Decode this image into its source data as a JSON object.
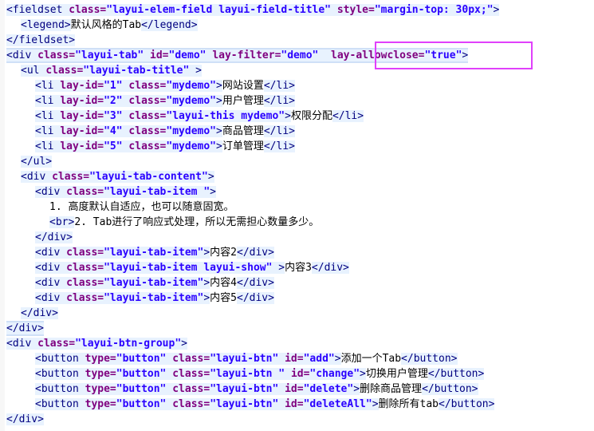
{
  "lines": [
    {
      "indent": 0,
      "segments": [
        {
          "t": "<fieldset ",
          "c": "tag"
        },
        {
          "t": "class=",
          "c": "attr"
        },
        {
          "t": "\"layui-elem-field layui-field-title\" ",
          "c": "val"
        },
        {
          "t": "style=",
          "c": "attr"
        },
        {
          "t": "\"margin-top: 30px;\"",
          "c": "val"
        },
        {
          "t": ">",
          "c": "tag"
        }
      ]
    },
    {
      "indent": 1,
      "segments": [
        {
          "t": "<legend>",
          "c": "tag"
        },
        {
          "t": "默认风格的Tab",
          "c": "txt"
        },
        {
          "t": "</legend>",
          "c": "tag"
        }
      ]
    },
    {
      "indent": 0,
      "segments": [
        {
          "t": "</fieldset>",
          "c": "tag"
        }
      ]
    },
    {
      "indent": 0,
      "selected": true,
      "segments": [
        {
          "t": "<div ",
          "c": "tag"
        },
        {
          "t": "class=",
          "c": "attr"
        },
        {
          "t": "\"layui-tab\" ",
          "c": "val"
        },
        {
          "t": "id=",
          "c": "attr"
        },
        {
          "t": "\"demo\" ",
          "c": "val"
        },
        {
          "t": "lay-filter=",
          "c": "attr"
        },
        {
          "t": "\"demo\"  ",
          "c": "val"
        },
        {
          "t": "lay-allowclose=",
          "c": "attr"
        },
        {
          "t": "\"true\"",
          "c": "val"
        },
        {
          "t": ">",
          "c": "tag"
        }
      ]
    },
    {
      "indent": 1,
      "segments": [
        {
          "t": "<ul ",
          "c": "tag"
        },
        {
          "t": "class=",
          "c": "attr"
        },
        {
          "t": "\"layui-tab-title\" ",
          "c": "val"
        },
        {
          "t": ">",
          "c": "tag"
        }
      ]
    },
    {
      "indent": 2,
      "segments": [
        {
          "t": "<li ",
          "c": "tag"
        },
        {
          "t": "lay-id=",
          "c": "attr"
        },
        {
          "t": "\"1\" ",
          "c": "val"
        },
        {
          "t": "class=",
          "c": "attr"
        },
        {
          "t": "\"mydemo\"",
          "c": "val"
        },
        {
          "t": ">",
          "c": "tag"
        },
        {
          "t": "网站设置",
          "c": "txt"
        },
        {
          "t": "</li>",
          "c": "tag"
        }
      ]
    },
    {
      "indent": 2,
      "segments": [
        {
          "t": "<li ",
          "c": "tag"
        },
        {
          "t": "lay-id=",
          "c": "attr"
        },
        {
          "t": "\"2\" ",
          "c": "val"
        },
        {
          "t": "class=",
          "c": "attr"
        },
        {
          "t": "\"mydemo\"",
          "c": "val"
        },
        {
          "t": ">",
          "c": "tag"
        },
        {
          "t": "用户管理",
          "c": "txt"
        },
        {
          "t": "</li>",
          "c": "tag"
        }
      ]
    },
    {
      "indent": 2,
      "segments": [
        {
          "t": "<li ",
          "c": "tag"
        },
        {
          "t": "lay-id=",
          "c": "attr"
        },
        {
          "t": "\"3\" ",
          "c": "val"
        },
        {
          "t": "class=",
          "c": "attr"
        },
        {
          "t": "\"layui-this mydemo\"",
          "c": "val"
        },
        {
          "t": ">",
          "c": "tag"
        },
        {
          "t": "权限分配",
          "c": "txt"
        },
        {
          "t": "</li>",
          "c": "tag"
        }
      ]
    },
    {
      "indent": 2,
      "segments": [
        {
          "t": "<li ",
          "c": "tag"
        },
        {
          "t": "lay-id=",
          "c": "attr"
        },
        {
          "t": "\"4\" ",
          "c": "val"
        },
        {
          "t": "class=",
          "c": "attr"
        },
        {
          "t": "\"mydemo\"",
          "c": "val"
        },
        {
          "t": ">",
          "c": "tag"
        },
        {
          "t": "商品管理",
          "c": "txt"
        },
        {
          "t": "</li>",
          "c": "tag"
        }
      ]
    },
    {
      "indent": 2,
      "segments": [
        {
          "t": "<li ",
          "c": "tag"
        },
        {
          "t": "lay-id=",
          "c": "attr"
        },
        {
          "t": "\"5\" ",
          "c": "val"
        },
        {
          "t": "class=",
          "c": "attr"
        },
        {
          "t": "\"mydemo\"",
          "c": "val"
        },
        {
          "t": ">",
          "c": "tag"
        },
        {
          "t": "订单管理",
          "c": "txt"
        },
        {
          "t": "</li>",
          "c": "tag"
        }
      ]
    },
    {
      "indent": 1,
      "segments": [
        {
          "t": "</ul>",
          "c": "tag"
        }
      ]
    },
    {
      "indent": 1,
      "segments": [
        {
          "t": "<div ",
          "c": "tag"
        },
        {
          "t": "class=",
          "c": "attr"
        },
        {
          "t": "\"layui-tab-content\"",
          "c": "val"
        },
        {
          "t": ">",
          "c": "tag"
        }
      ]
    },
    {
      "indent": 2,
      "segments": [
        {
          "t": "<div ",
          "c": "tag"
        },
        {
          "t": "class=",
          "c": "attr"
        },
        {
          "t": "\"layui-tab-item \"",
          "c": "val"
        },
        {
          "t": ">",
          "c": "tag"
        }
      ]
    },
    {
      "indent": 3,
      "segments": [
        {
          "t": "1. 高度默认自适应，也可以随意固宽。",
          "c": "txt"
        }
      ]
    },
    {
      "indent": 3,
      "segments": [
        {
          "t": "<br>",
          "c": "tag"
        },
        {
          "t": "2. Tab进行了响应式处理，所以无需担心数量多少。",
          "c": "txt"
        }
      ]
    },
    {
      "indent": 2,
      "segments": [
        {
          "t": "</div>",
          "c": "tag"
        }
      ]
    },
    {
      "indent": 2,
      "segments": [
        {
          "t": "<div ",
          "c": "tag"
        },
        {
          "t": "class=",
          "c": "attr"
        },
        {
          "t": "\"layui-tab-item\"",
          "c": "val"
        },
        {
          "t": ">",
          "c": "tag"
        },
        {
          "t": "内容2",
          "c": "txt"
        },
        {
          "t": "</div>",
          "c": "tag"
        }
      ]
    },
    {
      "indent": 2,
      "segments": [
        {
          "t": "<div ",
          "c": "tag"
        },
        {
          "t": "class=",
          "c": "attr"
        },
        {
          "t": "\"layui-tab-item layui-show\" ",
          "c": "val"
        },
        {
          "t": ">",
          "c": "tag"
        },
        {
          "t": "内容3",
          "c": "txt"
        },
        {
          "t": "</div>",
          "c": "tag"
        }
      ]
    },
    {
      "indent": 2,
      "segments": [
        {
          "t": "<div ",
          "c": "tag"
        },
        {
          "t": "class=",
          "c": "attr"
        },
        {
          "t": "\"layui-tab-item\"",
          "c": "val"
        },
        {
          "t": ">",
          "c": "tag"
        },
        {
          "t": "内容4",
          "c": "txt"
        },
        {
          "t": "</div>",
          "c": "tag"
        }
      ]
    },
    {
      "indent": 2,
      "segments": [
        {
          "t": "<div ",
          "c": "tag"
        },
        {
          "t": "class=",
          "c": "attr"
        },
        {
          "t": "\"layui-tab-item\"",
          "c": "val"
        },
        {
          "t": ">",
          "c": "tag"
        },
        {
          "t": "内容5",
          "c": "txt"
        },
        {
          "t": "</div>",
          "c": "tag"
        }
      ]
    },
    {
      "indent": 1,
      "segments": [
        {
          "t": "</div>",
          "c": "tag"
        }
      ]
    },
    {
      "indent": 0,
      "selected": true,
      "segments": [
        {
          "t": "</div>",
          "c": "tag"
        }
      ]
    },
    {
      "indent": 0,
      "segments": [
        {
          "t": "<div ",
          "c": "tag"
        },
        {
          "t": "class=",
          "c": "attr"
        },
        {
          "t": "\"layui-btn-group\"",
          "c": "val"
        },
        {
          "t": ">",
          "c": "tag"
        }
      ]
    },
    {
      "indent": 2,
      "segments": [
        {
          "t": "<button ",
          "c": "tag"
        },
        {
          "t": "type=",
          "c": "attr"
        },
        {
          "t": "\"button\" ",
          "c": "val"
        },
        {
          "t": "class=",
          "c": "attr"
        },
        {
          "t": "\"layui-btn\" ",
          "c": "val"
        },
        {
          "t": "id=",
          "c": "attr"
        },
        {
          "t": "\"add\"",
          "c": "val"
        },
        {
          "t": ">",
          "c": "tag"
        },
        {
          "t": "添加一个Tab",
          "c": "txt"
        },
        {
          "t": "</button>",
          "c": "tag"
        }
      ]
    },
    {
      "indent": 2,
      "segments": [
        {
          "t": "<button ",
          "c": "tag"
        },
        {
          "t": "type=",
          "c": "attr"
        },
        {
          "t": "\"button\" ",
          "c": "val"
        },
        {
          "t": "class=",
          "c": "attr"
        },
        {
          "t": "\"layui-btn \" ",
          "c": "val"
        },
        {
          "t": "id=",
          "c": "attr"
        },
        {
          "t": "\"change\"",
          "c": "val"
        },
        {
          "t": ">",
          "c": "tag"
        },
        {
          "t": "切换用户管理",
          "c": "txt"
        },
        {
          "t": "</button>",
          "c": "tag"
        }
      ]
    },
    {
      "indent": 2,
      "segments": [
        {
          "t": "<button ",
          "c": "tag"
        },
        {
          "t": "type=",
          "c": "attr"
        },
        {
          "t": "\"button\" ",
          "c": "val"
        },
        {
          "t": "class=",
          "c": "attr"
        },
        {
          "t": "\"layui-btn\" ",
          "c": "val"
        },
        {
          "t": "id=",
          "c": "attr"
        },
        {
          "t": "\"delete\"",
          "c": "val"
        },
        {
          "t": ">",
          "c": "tag"
        },
        {
          "t": "删除商品管理",
          "c": "txt"
        },
        {
          "t": "</button>",
          "c": "tag"
        }
      ]
    },
    {
      "indent": 2,
      "segments": [
        {
          "t": "<button ",
          "c": "tag"
        },
        {
          "t": "type=",
          "c": "attr"
        },
        {
          "t": "\"button\" ",
          "c": "val"
        },
        {
          "t": "class=",
          "c": "attr"
        },
        {
          "t": "\"layui-btn\" ",
          "c": "val"
        },
        {
          "t": "id=",
          "c": "attr"
        },
        {
          "t": "\"deleteAll\"",
          "c": "val"
        },
        {
          "t": ">",
          "c": "tag"
        },
        {
          "t": "删除所有tab",
          "c": "txt"
        },
        {
          "t": "</button>",
          "c": "tag"
        }
      ]
    },
    {
      "indent": 0,
      "segments": [
        {
          "t": "</div>",
          "c": "tag"
        }
      ]
    }
  ],
  "colors": {
    "background": "#ffffff",
    "tag": "#000080",
    "attribute": "#7f007f",
    "value": "#2a00ff",
    "line_highlight": "#e8f2fe",
    "callout_border": "#e040fb"
  }
}
